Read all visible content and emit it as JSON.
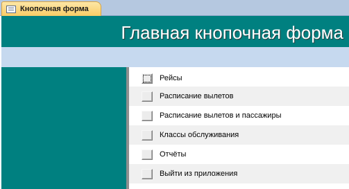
{
  "tab": {
    "label": "Кнопочная форма",
    "icon": "form-icon"
  },
  "header": {
    "title": "Главная кнопочная форма"
  },
  "menu": {
    "items": [
      {
        "label": "Рейсы"
      },
      {
        "label": "Расписание вылетов"
      },
      {
        "label": "Расписание вылетов и пассажиры"
      },
      {
        "label": "Классы обслуживания"
      },
      {
        "label": "Отчёты"
      },
      {
        "label": "Выйти из приложения"
      }
    ]
  },
  "colors": {
    "header_bg": "#008080",
    "band_bg": "#c6d9ef",
    "tab_bg": "#f9cc66"
  }
}
